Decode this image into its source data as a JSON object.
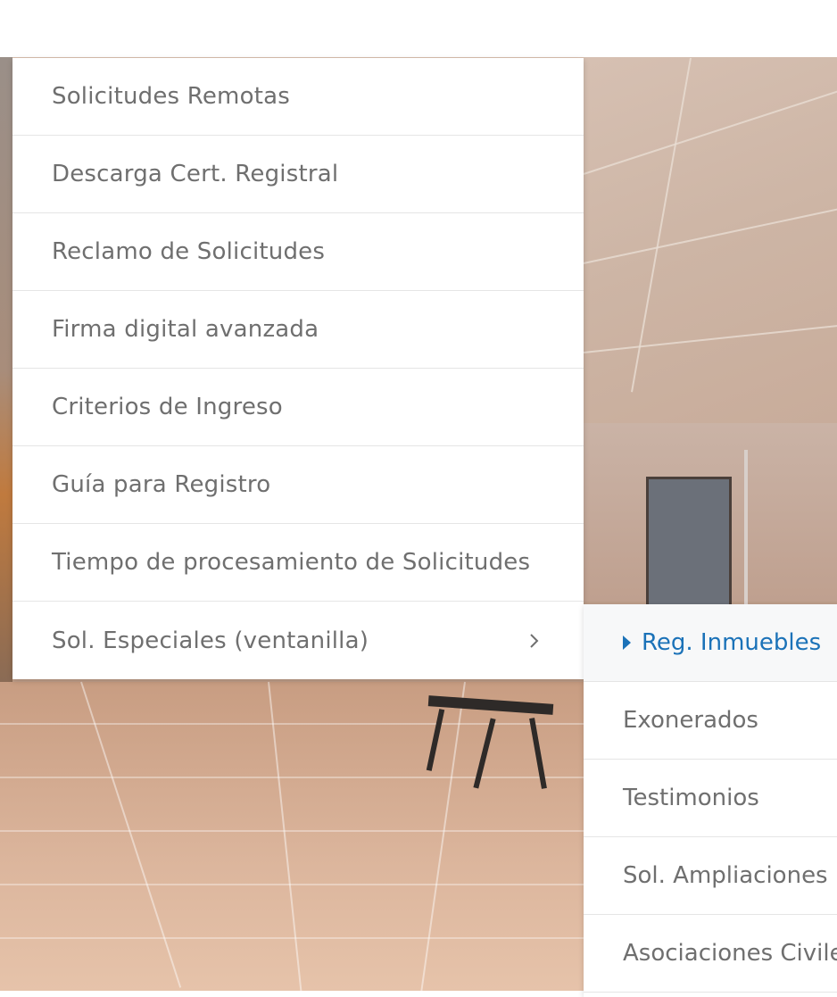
{
  "menu": {
    "items": [
      {
        "label": "Solicitudes Remotas"
      },
      {
        "label": "Descarga Cert. Registral"
      },
      {
        "label": "Reclamo de Solicitudes"
      },
      {
        "label": "Firma digital avanzada"
      },
      {
        "label": "Criterios de Ingreso"
      },
      {
        "label": "Guía para Registro"
      },
      {
        "label": "Tiempo de procesamiento de Solicitudes"
      },
      {
        "label": "Sol. Especiales (ventanilla)",
        "has_submenu": true,
        "icon": "chevron-right-icon"
      }
    ]
  },
  "submenu": {
    "items": [
      {
        "label": "Reg. Inmuebles",
        "active": true,
        "icon": "caret-right-icon"
      },
      {
        "label": "Exonerados"
      },
      {
        "label": "Testimonios"
      },
      {
        "label": "Sol. Ampliaciones"
      },
      {
        "label": "Asociaciones Civiles"
      }
    ]
  },
  "colors": {
    "accent": "#1b72b8",
    "menu_text": "#6f6f6f",
    "divider": "#e5e5e5",
    "menu_bg": "#ffffff"
  }
}
